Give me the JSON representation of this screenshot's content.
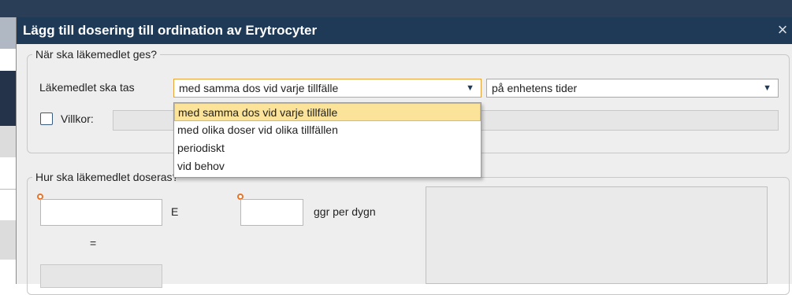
{
  "dialog": {
    "title": "Lägg till dosering till ordination av Erytrocyter",
    "close_glyph": "×"
  },
  "when": {
    "legend": "När ska läkemedlet ges?",
    "take_label": "Läkemedlet ska tas",
    "dose_mode": {
      "selected": "med samma dos vid varje tillfälle",
      "options": [
        "med samma dos vid varje tillfälle",
        "med olika doser vid olika tillfällen",
        "periodiskt",
        "vid behov"
      ]
    },
    "timing": {
      "selected": "på enhetens tider"
    },
    "conditions_label": "Villkor:"
  },
  "dosing": {
    "legend": "Hur ska läkemedlet doseras?",
    "unit": "E",
    "frequency_unit": "ggr per dygn",
    "equals": "="
  },
  "icons": {
    "dropdown_arrow": "▼"
  },
  "colors": {
    "titlebar": "#1f3a57",
    "highlight": "#fbe39a",
    "required": "#e8742a"
  }
}
